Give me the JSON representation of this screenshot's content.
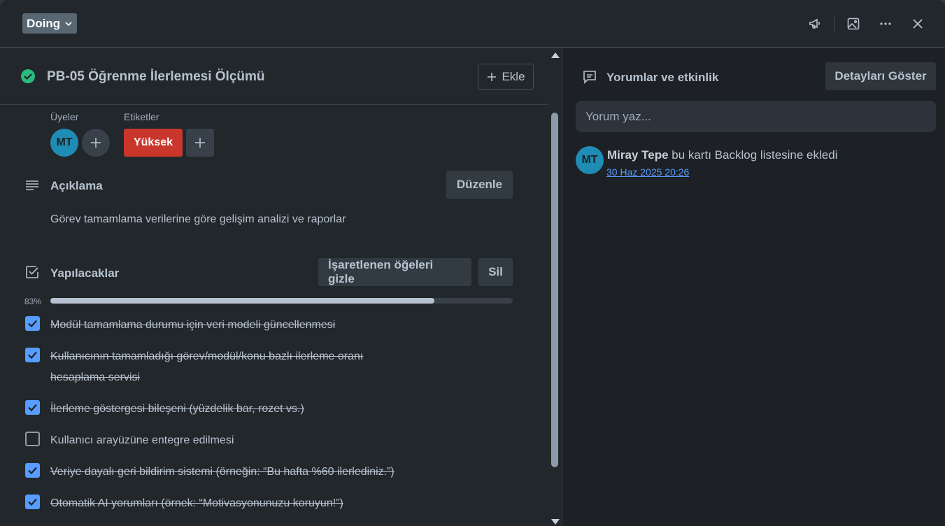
{
  "header": {
    "list_name": "Doing",
    "icons": [
      "megaphone-icon",
      "image-icon",
      "more-icon",
      "close-icon"
    ]
  },
  "card": {
    "status_icon": "check-circle-icon",
    "status_color": "#2abb7f",
    "title": "PB-05 Öğrenme İlerlemesi Ölçümü",
    "add_label": "Ekle",
    "members_label": "Üyeler",
    "member_initials": "MT",
    "labels_label": "Etiketler",
    "label_name": "Yüksek",
    "label_color": "#c9372c"
  },
  "description": {
    "title": "Açıklama",
    "edit_label": "Düzenle",
    "text": "Görev tamamlama verilerine göre gelişim analizi ve raporlar"
  },
  "checklist": {
    "title": "Yapılacaklar",
    "hide_checked_label": "İşaretlenen öğeleri gizle",
    "delete_label": "Sil",
    "progress_text": "83%",
    "progress": 0.83,
    "items": [
      {
        "text": "Modül tamamlama durumu için veri modeli güncellenmesi",
        "checked": true
      },
      {
        "text": "Kullanıcının tamamladığı görev/modül/konu bazlı ilerleme oranı hesaplama servisi",
        "checked": true
      },
      {
        "text": "İlerleme göstergesi bileşeni (yüzdelik bar, rozet vs.)",
        "checked": true
      },
      {
        "text": "Kullanıcı arayüzüne entegre edilmesi",
        "checked": false
      },
      {
        "text": "Veriye dayalı geri bildirim sistemi (örneğin: “Bu hafta %60 ilerlediniz.”)",
        "checked": true
      },
      {
        "text": "Otomatik AI yorumları (örnek: “Motivasyonunuzu koruyun!”)",
        "checked": true
      }
    ]
  },
  "activity": {
    "title": "Yorumlar ve etkinlik",
    "show_details_label": "Detayları Göster",
    "comment_placeholder": "Yorum yaz...",
    "entries": [
      {
        "initials": "MT",
        "user": "Miray Tepe",
        "action": "bu kartı Backlog listesine ekledi",
        "time": "30 Haz 2025 20:26"
      }
    ]
  },
  "colors": {
    "accent": "#579dff",
    "avatar": "#1f8cb5"
  }
}
